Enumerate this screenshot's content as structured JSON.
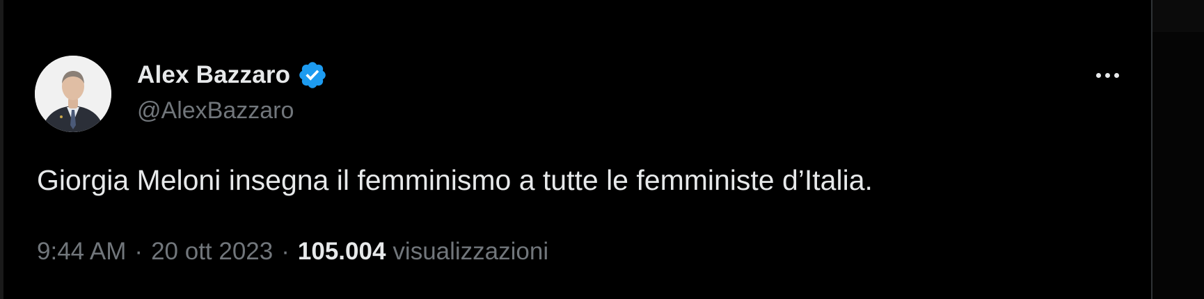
{
  "tweet": {
    "author": {
      "display_name": "Alex Bazzaro",
      "handle": "@AlexBazzaro",
      "verified": true,
      "avatar": "profile-photo"
    },
    "text": "Giorgia Meloni insegna il femminismo a tutte le femministe d’Italia.",
    "time": "9:44 AM",
    "separator": "·",
    "date": "20 ott 2023",
    "views_count": "105.004",
    "views_label": "visualizzazioni",
    "more_icon": "more-horizontal-icon"
  },
  "colors": {
    "background": "#000000",
    "primary_text": "#e7e9ea",
    "secondary_text": "#71767b",
    "verified_badge": "#1d9bf0"
  }
}
